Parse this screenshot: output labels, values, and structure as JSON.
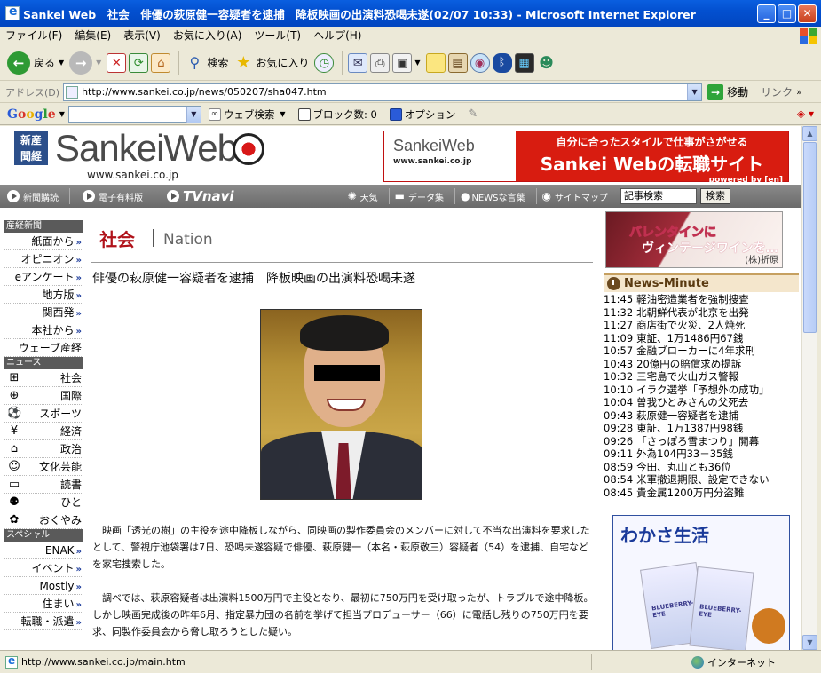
{
  "window": {
    "title": "Sankei Web　社会　俳優の萩原健一容疑者を逮捕　降板映画の出演料恐喝未遂(02/07 10:33) - Microsoft Internet Explorer",
    "min": "_",
    "max": "□",
    "close": "✕"
  },
  "menu": {
    "items": [
      "ファイル(F)",
      "編集(E)",
      "表示(V)",
      "お気に入り(A)",
      "ツール(T)",
      "ヘルプ(H)"
    ]
  },
  "toolbar": {
    "back": "戻る",
    "search": "検索",
    "favorites": "お気に入り"
  },
  "address": {
    "label": "アドレス(D)",
    "url": "http://www.sankei.co.jp/news/050207/sha047.htm",
    "go": "移動",
    "links": "リンク"
  },
  "google": {
    "logo": "Google",
    "web_search": "ウェブ検索",
    "popup_blocked": "ブロック数: 0",
    "options": "オプション"
  },
  "site": {
    "badge": "新産\n聞経",
    "logo_text": "SankeiWeb",
    "url": "www.sankei.co.jp",
    "ad_logo": "SankeiWeb",
    "ad_url": "www.sankei.co.jp",
    "ad_line1": "自分に合ったスタイルで仕事がさがせる",
    "ad_line2": "Sankei Webの転職サイト",
    "ad_line3": "powered by [en]"
  },
  "nav": {
    "subscribe": "新聞購読",
    "epaper": "電子有料版",
    "tvnavi": "TVnavi",
    "weather": "天気",
    "data": "データ集",
    "news_words": "NEWSな言葉",
    "sitemap": "サイトマップ",
    "search_placeholder": "記事検索",
    "search_button": "検索"
  },
  "leftnav": {
    "sections": [
      {
        "head": "産経新聞",
        "items": [
          "紙面から",
          "オピニオン",
          "eアンケート",
          "地方版",
          "関西発",
          "本社から",
          "ウェーブ産経"
        ]
      },
      {
        "head": "ニュース",
        "items": [
          "社会",
          "国際",
          "スポーツ",
          "経済",
          "政治",
          "文化芸能",
          "読書",
          "ひと",
          "おくやみ"
        ]
      },
      {
        "head": "スペシャル",
        "items": [
          "ENAK",
          "イベント",
          "Mostly",
          "住まい",
          "転職・派遣"
        ]
      }
    ],
    "arrow": "»"
  },
  "article": {
    "section_jp": "社会",
    "section_en": "Nation",
    "headline": "俳優の萩原健一容疑者を逮捕　降板映画の出演料恐喝未遂",
    "paragraphs": [
      "　映画「透光の樹」の主役を途中降板しながら、同映画の製作委員会のメンバーに対して不当な出演料を要求したとして、警視庁池袋署は7日、恐喝未遂容疑で俳優、萩原健一（本名・萩原敬三）容疑者（54）を逮捕、自宅などを家宅捜索した。",
      "　調べでは、萩原容疑者は出演料1500万円で主役となり、最初に750万円を受け取ったが、トラブルで途中降板。しかし映画完成後の昨年6月、指定暴力団の名前を挙げて担当プロデューサー（66）に電話し残りの750万円を要求、同製作委員会から脅し取ろうとした疑い。"
    ]
  },
  "right": {
    "ad1_line1": "バレンタインに",
    "ad1_line2": "ヴィンテージワインを…",
    "ad1_sponsor": "(株)折原",
    "news_minute_title": "News-Minute",
    "news_minute": [
      {
        "time": "11:45",
        "text": "軽油密造業者を強制捜査"
      },
      {
        "time": "11:32",
        "text": "北朝鮮代表が北京を出発"
      },
      {
        "time": "11:27",
        "text": "商店街で火災、2人焼死"
      },
      {
        "time": "11:09",
        "text": "東証、1万1486円67銭"
      },
      {
        "time": "10:57",
        "text": "金融ブローカーに4年求刑"
      },
      {
        "time": "10:43",
        "text": "20億円の賠償求め提訴"
      },
      {
        "time": "10:32",
        "text": "三宅島で火山ガス警報"
      },
      {
        "time": "10:10",
        "text": "イラク選挙「予想外の成功」"
      },
      {
        "time": "10:04",
        "text": "曽我ひとみさんの父死去"
      },
      {
        "time": "09:43",
        "text": "萩原健一容疑者を逮捕"
      },
      {
        "time": "09:28",
        "text": "東証、1万1387円98銭"
      },
      {
        "time": "09:26",
        "text": "「さっぽろ雪まつり」開幕"
      },
      {
        "time": "09:11",
        "text": "外為104円33－35銭"
      },
      {
        "time": "08:59",
        "text": "今田、丸山とも36位"
      },
      {
        "time": "08:54",
        "text": "米軍撤退期限、設定できない"
      },
      {
        "time": "08:45",
        "text": "貴金属1200万円分盗難"
      }
    ],
    "ad2_title": "わかさ生活",
    "ad2_label": "BLUEBERRY-EYE"
  },
  "status": {
    "text": "http://www.sankei.co.jp/main.htm",
    "zone": "インターネット"
  }
}
